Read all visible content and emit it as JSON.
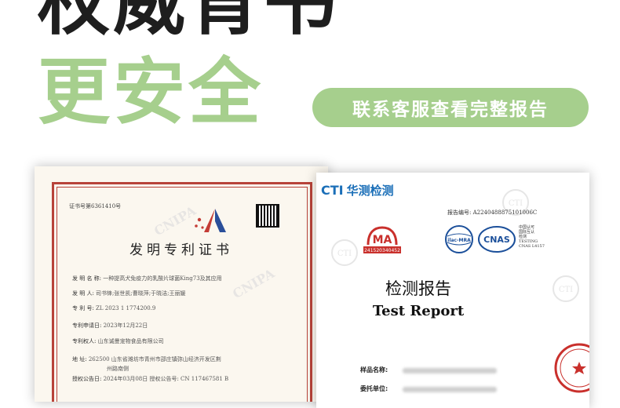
{
  "headline": {
    "line1": "权威背书",
    "line2": "更安全"
  },
  "cta": {
    "label": "联系客服查看完整报告"
  },
  "patent": {
    "cert_no": "证书号第6361410号",
    "title": "发明专利证书",
    "rows": [
      {
        "label": "发 明 名 称:",
        "value": "一种提高犬免疫力的乳酸片球菌King73及其应用"
      },
      {
        "label": "发 明 人:",
        "value": "司书锋;张世凯;曹晓萍;于晓洁;王丽媛"
      },
      {
        "label": "专 利 号:",
        "value": "ZL 2023 1 1774200.9"
      },
      {
        "label": "专利申请日:",
        "value": "2023年12月22日"
      },
      {
        "label": "专利权人:",
        "value": "山东诚曼宠物食品有限公司"
      },
      {
        "label": "地 址:",
        "value": "262500 山东省潍坊市青州市邵庄镇弥山经济开发区荆"
      },
      {
        "label": "",
        "value": "州路南侧"
      },
      {
        "label": "授权公告日:",
        "value": "2024年03月08日     授权公告号: CN 117467581 B"
      }
    ],
    "watermark": "CNIPA"
  },
  "report": {
    "brand_logo": "CTI",
    "brand_name": "华测检测",
    "report_no": "报告编号: A2240488875101006C",
    "ma_label": "MA",
    "ma_number": "241520340452",
    "ilac_label": "ilac-MRA",
    "cnas_label": "CNAS",
    "cnas_text": [
      "中国认可",
      "国际互认",
      "检测",
      "TESTING",
      "CNAS L4157"
    ],
    "title_cn": "检测报告",
    "title_en": "Test Report",
    "fields": [
      "样品名称:",
      "委托单位:"
    ],
    "watermark": "CTI"
  },
  "colors": {
    "headline_dark": "#1e1e1e",
    "accent_green": "#a6cf8d",
    "seal_red": "#b8433a",
    "brand_blue": "#1b6fb8"
  }
}
